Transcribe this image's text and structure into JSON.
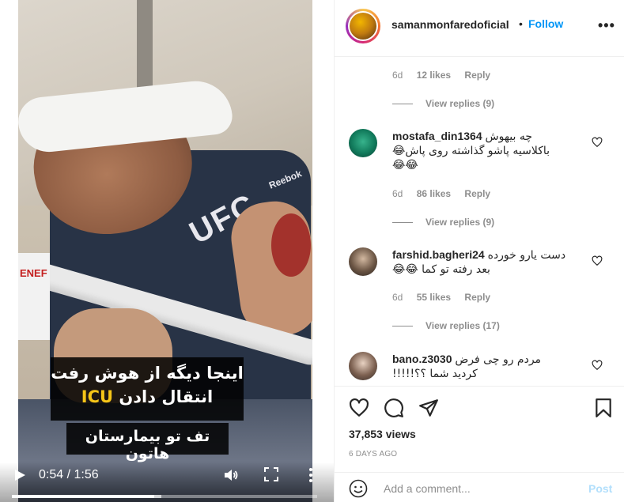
{
  "video": {
    "caption_line1": "اینجا دیگه از هوش رفت",
    "caption_line2_icu": "ICU",
    "caption_line2_rest": "انتقال دادن",
    "caption_line3": "تف تو بیمارستان هاتون",
    "shirt_logo": "UFC",
    "shirt_brand": "Reebok",
    "sign_text": "ENEF",
    "time_display": "0:54 / 1:56",
    "progress_fraction": 0.4655,
    "buffer_fraction": 0.49
  },
  "header": {
    "username": "samanmonfaredoficial",
    "separator": "•",
    "follow_label": "Follow",
    "more_label": "•••"
  },
  "comments": {
    "top_meta": {
      "time": "6d",
      "likes": "12 likes",
      "reply": "Reply"
    },
    "top_view_replies": "View replies (9)",
    "items": [
      {
        "username": "mostafa_din1364",
        "text_line1": "چه بیهوش",
        "text_line2": "باکلاسیه پاشو گذاشته روی پاش😂",
        "text_line3": "😂😂",
        "time": "6d",
        "likes": "86 likes",
        "reply": "Reply",
        "view_replies": "View replies (9)"
      },
      {
        "username": "farshid.bagheri24",
        "text_line1": "دست یارو خورده",
        "text_line2": "بعد رفته تو کما 😂😂",
        "time": "6d",
        "likes": "55 likes",
        "reply": "Reply",
        "view_replies": "View replies (17)"
      },
      {
        "username": "bano.z3030",
        "text_line1": "مردم رو چی فرض",
        "text_line2": "کردید شما ؟؟!!!!!"
      }
    ]
  },
  "actions": {
    "views": "37,853 views",
    "date": "6 DAYS AGO",
    "comment_placeholder": "Add a comment...",
    "post_label": "Post"
  },
  "colors": {
    "accent_blue": "#0095f6",
    "post_disabled": "#b2dffc",
    "muted_text": "#8e8e8e",
    "divider": "#efefef"
  },
  "icons": [
    "play-icon",
    "volume-icon",
    "fullscreen-icon",
    "more-vertical-icon",
    "heart-icon",
    "comment-icon",
    "share-icon",
    "bookmark-icon",
    "emoji-icon",
    "more-horizontal-icon"
  ]
}
